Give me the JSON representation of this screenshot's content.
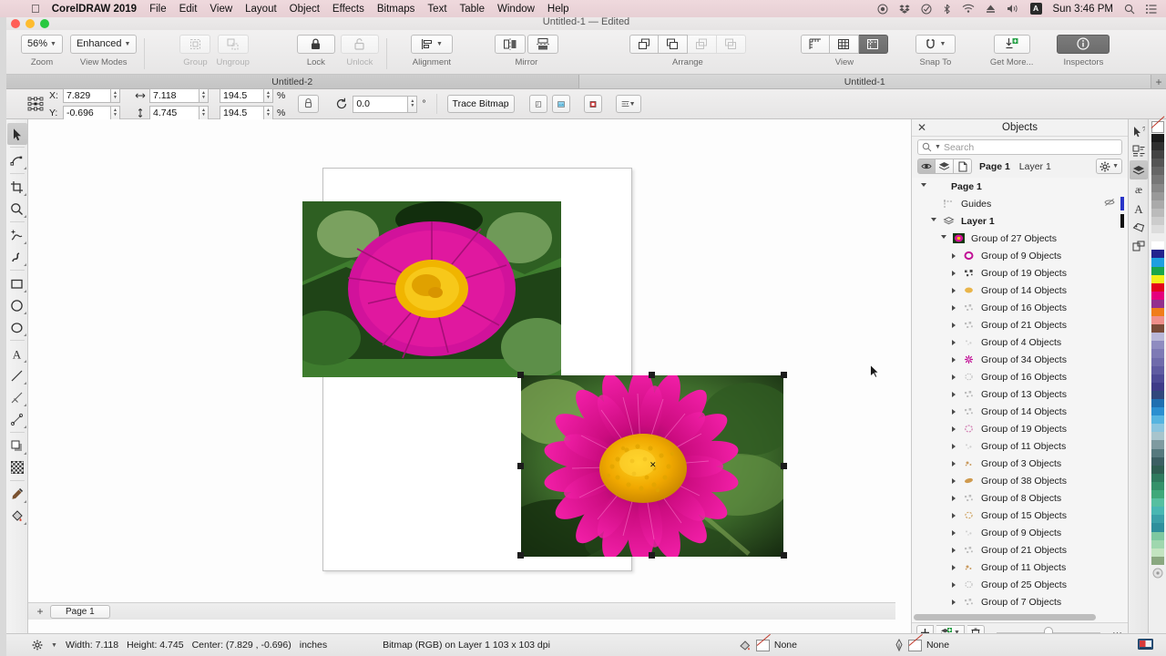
{
  "macbar": {
    "apple_icon": "apple-icon",
    "app_name": "CorelDRAW 2019",
    "menus": [
      "File",
      "Edit",
      "View",
      "Layout",
      "Object",
      "Effects",
      "Bitmaps",
      "Text",
      "Table",
      "Window",
      "Help"
    ],
    "status_icons": [
      "screen-record-icon",
      "dropbox-icon",
      "check-circle-icon",
      "bluetooth-icon",
      "wifi-icon",
      "eject-icon",
      "volume-icon"
    ],
    "keyboard_badge": "A",
    "clock": "Sun 3:46 PM",
    "search_icon": "search-icon",
    "control_center_icon": "list-icon"
  },
  "window": {
    "doc_title": "Untitled-1 — Edited"
  },
  "ribbon": {
    "zoom": {
      "value": "56%",
      "label": "Zoom"
    },
    "view_modes": {
      "value": "Enhanced",
      "label": "View Modes"
    },
    "group": {
      "label": "Group",
      "enabled": false
    },
    "ungroup": {
      "label": "Ungroup",
      "enabled": false
    },
    "lock": {
      "label": "Lock",
      "enabled": true
    },
    "unlock": {
      "label": "Unlock",
      "enabled": false
    },
    "alignment": {
      "label": "Alignment"
    },
    "mirror": {
      "label": "Mirror"
    },
    "arrange": {
      "label": "Arrange"
    },
    "view": {
      "label": "View"
    },
    "snap_to": {
      "label": "Snap To"
    },
    "get_more": {
      "label": "Get More..."
    },
    "inspectors": {
      "label": "Inspectors"
    }
  },
  "tabs": {
    "items": [
      {
        "label": "Untitled-2",
        "active": false
      },
      {
        "label": "Untitled-1",
        "active": true
      }
    ],
    "add_label": "+"
  },
  "propbar": {
    "x_label": "X:",
    "x_value": "7.829",
    "y_label": "Y:",
    "y_value": "-0.696",
    "width_value": "7.118",
    "height_value": "4.745",
    "scale_h_value": "194.5",
    "scale_v_value": "194.5",
    "percent": "%",
    "rotation_value": "0.0",
    "degree": "°",
    "trace_bitmap": "Trace Bitmap"
  },
  "toolbox": {
    "tools": [
      "pick-tool-icon",
      "shape-tool-icon",
      "crop-tool-icon",
      "zoom-tool-icon",
      "freehand-tool-icon",
      "artistic-media-tool-icon",
      "rectangle-tool-icon",
      "ellipse-tool-icon",
      "polygon-tool-icon",
      "text-tool-icon",
      "line-tool-icon",
      "dimension-tool-icon",
      "connector-tool-icon",
      "drop-shadow-tool-icon",
      "transparency-tool-icon",
      "color-eyedropper-tool-icon",
      "interactive-fill-tool-icon"
    ]
  },
  "canvas": {
    "page_label": "Page 1",
    "add_page": "+"
  },
  "objects_panel": {
    "title": "Objects",
    "close_icon": "close-icon",
    "search_placeholder": "Search",
    "search_value": "",
    "view_buttons": [
      "objects-view-icon",
      "layers-view-icon",
      "pages-view-icon"
    ],
    "breadcrumb_page": "Page 1",
    "breadcrumb_layer": "Layer 1",
    "options_icon": "gear-icon",
    "tree": [
      {
        "label": "Page 1",
        "depth": 0,
        "bold": true,
        "expander": "open",
        "icon": "none"
      },
      {
        "label": "Guides",
        "depth": 1,
        "bold": false,
        "expander": "none",
        "icon": "guides-icon",
        "bar": "#2a35c8"
      },
      {
        "label": "Layer 1",
        "depth": 1,
        "bold": true,
        "expander": "open",
        "icon": "layer-icon",
        "bar": "#111111"
      },
      {
        "label": "Group of 27 Objects",
        "depth": 2,
        "bold": false,
        "expander": "open",
        "icon": "flower-thumb"
      },
      {
        "label": "Group of 9 Objects",
        "depth": 3,
        "bold": false,
        "expander": "closed",
        "icon": "magenta-ring"
      },
      {
        "label": "Group of 19 Objects",
        "depth": 3,
        "bold": false,
        "expander": "closed",
        "icon": "dark-specks"
      },
      {
        "label": "Group of 14 Objects",
        "depth": 3,
        "bold": false,
        "expander": "closed",
        "icon": "yellow-blob"
      },
      {
        "label": "Group of 16 Objects",
        "depth": 3,
        "bold": false,
        "expander": "closed",
        "icon": "faint-specks"
      },
      {
        "label": "Group of 21 Objects",
        "depth": 3,
        "bold": false,
        "expander": "closed",
        "icon": "faint-specks"
      },
      {
        "label": "Group of 4 Objects",
        "depth": 3,
        "bold": false,
        "expander": "closed",
        "icon": "tiny-specks"
      },
      {
        "label": "Group of 34 Objects",
        "depth": 3,
        "bold": false,
        "expander": "closed",
        "icon": "magenta-burst"
      },
      {
        "label": "Group of 16 Objects",
        "depth": 3,
        "bold": false,
        "expander": "closed",
        "icon": "faint-ring"
      },
      {
        "label": "Group of 13 Objects",
        "depth": 3,
        "bold": false,
        "expander": "closed",
        "icon": "faint-specks"
      },
      {
        "label": "Group of 14 Objects",
        "depth": 3,
        "bold": false,
        "expander": "closed",
        "icon": "faint-specks"
      },
      {
        "label": "Group of 19 Objects",
        "depth": 3,
        "bold": false,
        "expander": "closed",
        "icon": "pink-ring"
      },
      {
        "label": "Group of 11 Objects",
        "depth": 3,
        "bold": false,
        "expander": "closed",
        "icon": "tiny-specks"
      },
      {
        "label": "Group of 3 Objects",
        "depth": 3,
        "bold": false,
        "expander": "closed",
        "icon": "tan-speck"
      },
      {
        "label": "Group of 38 Objects",
        "depth": 3,
        "bold": false,
        "expander": "closed",
        "icon": "tan-blob"
      },
      {
        "label": "Group of 8 Objects",
        "depth": 3,
        "bold": false,
        "expander": "closed",
        "icon": "faint-specks"
      },
      {
        "label": "Group of 15 Objects",
        "depth": 3,
        "bold": false,
        "expander": "closed",
        "icon": "tan-ring"
      },
      {
        "label": "Group of 9 Objects",
        "depth": 3,
        "bold": false,
        "expander": "closed",
        "icon": "tiny-specks"
      },
      {
        "label": "Group of 21 Objects",
        "depth": 3,
        "bold": false,
        "expander": "closed",
        "icon": "faint-specks"
      },
      {
        "label": "Group of 11 Objects",
        "depth": 3,
        "bold": false,
        "expander": "closed",
        "icon": "tan-speck"
      },
      {
        "label": "Group of 25 Objects",
        "depth": 3,
        "bold": false,
        "expander": "closed",
        "icon": "faint-ring"
      },
      {
        "label": "Group of 7 Objects",
        "depth": 3,
        "bold": false,
        "expander": "closed",
        "icon": "faint-specks"
      }
    ],
    "footer": {
      "new_layer_icon": "plus-icon",
      "new_master_layer_icon": "new-master-layer-icon",
      "delete_icon": "trash-icon",
      "more_icon": "more-options-icon"
    }
  },
  "docker_rail": [
    "hints-icon",
    "properties-icon",
    "objects-icon",
    "symbols-icon",
    "text-icon",
    "styles-icon",
    "page-layout-icon"
  ],
  "palette": {
    "no_color_swatch": "none-swatch",
    "colors": [
      "#1a1a1a",
      "#2f2f2f",
      "#434343",
      "#555555",
      "#666666",
      "#777777",
      "#888888",
      "#999999",
      "#aaaaaa",
      "#bbbbbb",
      "#cccccc",
      "#dddddd",
      "#eeeeee",
      "#ffffff",
      "#23238e",
      "#1e9fe0",
      "#1aa64a",
      "#f2ef1a",
      "#e3051b",
      "#e5007d",
      "#93308e",
      "#f07d1a",
      "#ef8f8a",
      "#7a4b38",
      "#b9b7d8",
      "#8f8cc0",
      "#7e7ab5",
      "#6f6bab",
      "#5f5ba1",
      "#4e4a95",
      "#3f3b88",
      "#31487c",
      "#1f6fb0",
      "#2b8fd0",
      "#56b4e0",
      "#8ac4de",
      "#a8c4cc",
      "#7f9aa0",
      "#56797e",
      "#3c5f63",
      "#2f5e52",
      "#2f7a5e",
      "#35916a",
      "#3fa87a",
      "#56bfa0",
      "#49b7b2",
      "#3ba0a8",
      "#2f8f9c",
      "#7ec8a0",
      "#9fd7ae",
      "#c3e4c0",
      "#8aa880"
    ]
  },
  "statusbar": {
    "settings_icon": "gear-icon",
    "width_label": "Width: 7.118",
    "height_label": "Height: 4.745",
    "center_label": "Center: (7.829 , -0.696)",
    "units": "inches",
    "object_info": "Bitmap (RGB) on Layer 1 103 x 103 dpi",
    "fill_icon": "fill-icon",
    "fill_value": "None",
    "outline_icon": "outline-pen-icon",
    "outline_value": "None",
    "color_proof_icon": "color-proof-icon"
  }
}
